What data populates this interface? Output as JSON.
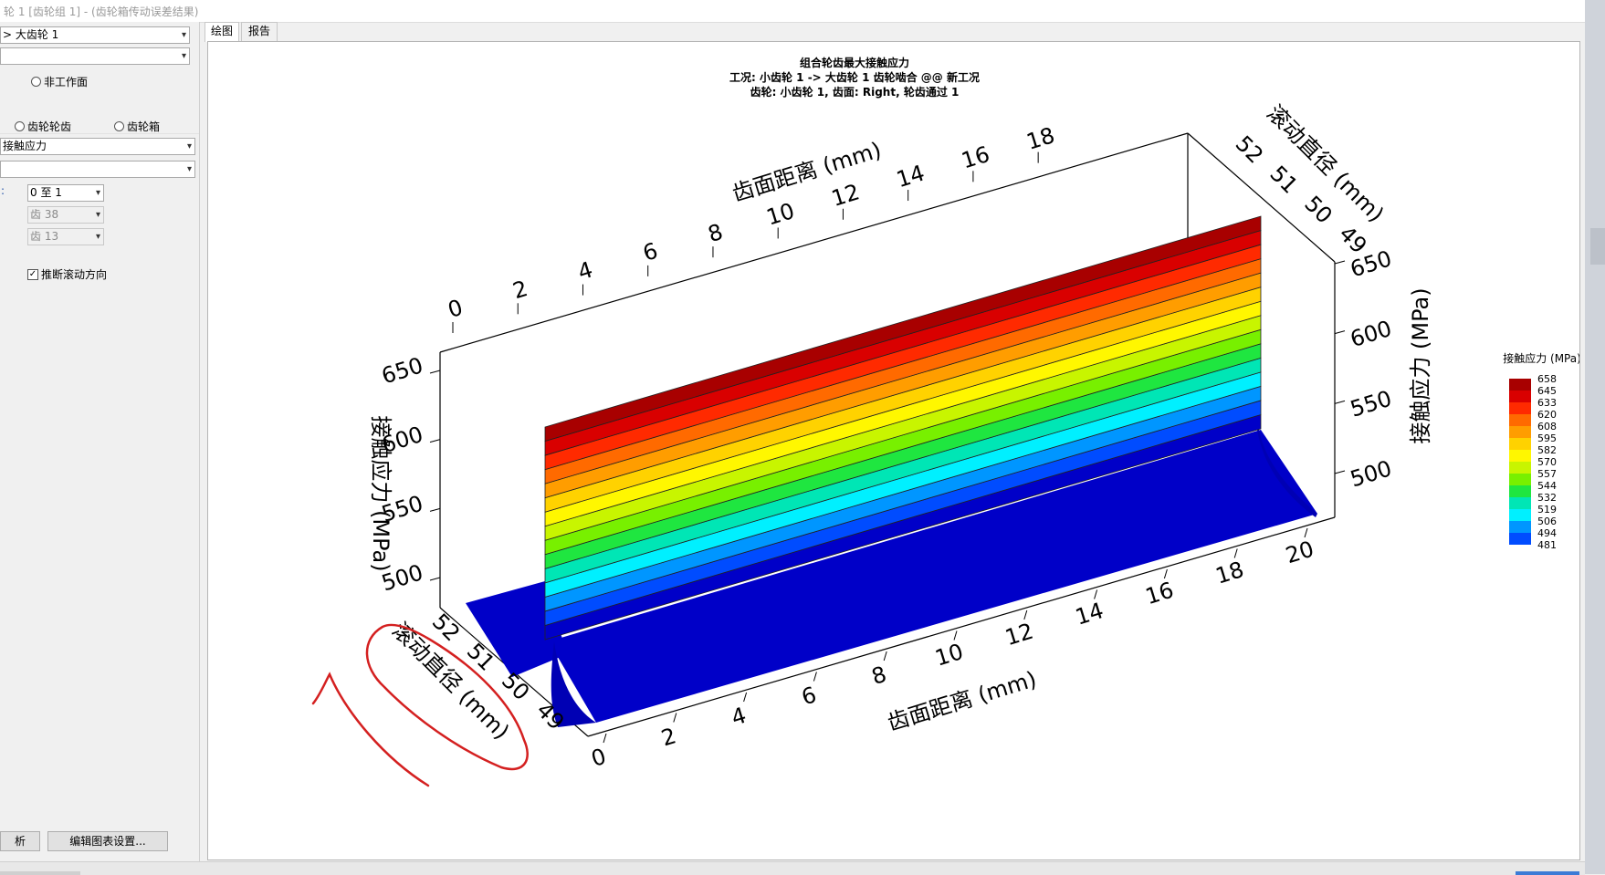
{
  "window": {
    "title": "轮 1 [齿轮组 1] - (齿轮箱传动误差结果)"
  },
  "left_panel": {
    "combo_gear": "> 大齿轮 1",
    "combo_blank": "",
    "radio_nonworking": "非工作面",
    "radio_gear_tooth": "齿轮轮齿",
    "radio_gearbox": "齿轮箱",
    "combo_result": "接触应力",
    "combo_blank2": "",
    "range_label": ":",
    "combo_range": "0 至 1",
    "combo_tooth_a": "齿 38",
    "combo_tooth_b": "齿 13",
    "checkbox_infer": "推断滚动方向",
    "btn_analysis": "析",
    "btn_edit_chart": "编辑图表设置..."
  },
  "tabs": [
    {
      "label": "绘图"
    },
    {
      "label": "报告"
    }
  ],
  "chart_data": {
    "type": "3d-surface",
    "title": "组合轮齿最大接触应力",
    "subtitle1": "工况: 小齿轮 1 -> 大齿轮 1 齿轮啮合 @@ 新工况",
    "subtitle2": "齿轮: 小齿轮 1, 齿面: Right, 轮齿通过 1",
    "x_axis_label": "齿面距离 (mm)",
    "x_ticks": [
      0,
      2,
      4,
      6,
      8,
      10,
      12,
      14,
      16,
      18,
      20
    ],
    "x_top_ticks": [
      "0",
      "2",
      "4",
      "6",
      "8",
      "10",
      "12",
      "14",
      "16",
      "18"
    ],
    "y_axis_label": "滚动直径 (mm)",
    "y_ticks": [
      52,
      51,
      50,
      49
    ],
    "z_axis_label": "接触应力 (MPa)",
    "z_ticks": [
      500,
      550,
      600,
      650
    ],
    "legend": {
      "title": "接触应力 (MPa)",
      "levels": [
        658,
        645,
        633,
        620,
        608,
        595,
        582,
        570,
        557,
        544,
        532,
        519,
        506,
        494,
        481
      ],
      "colors": [
        "#a80000",
        "#d90000",
        "#ff2a00",
        "#ff6a00",
        "#ff9d00",
        "#ffd200",
        "#fff700",
        "#c8f500",
        "#78f000",
        "#1fe640",
        "#00e6b5",
        "#00f0ff",
        "#0096ff",
        "#004cff",
        "#0000c8"
      ]
    }
  }
}
